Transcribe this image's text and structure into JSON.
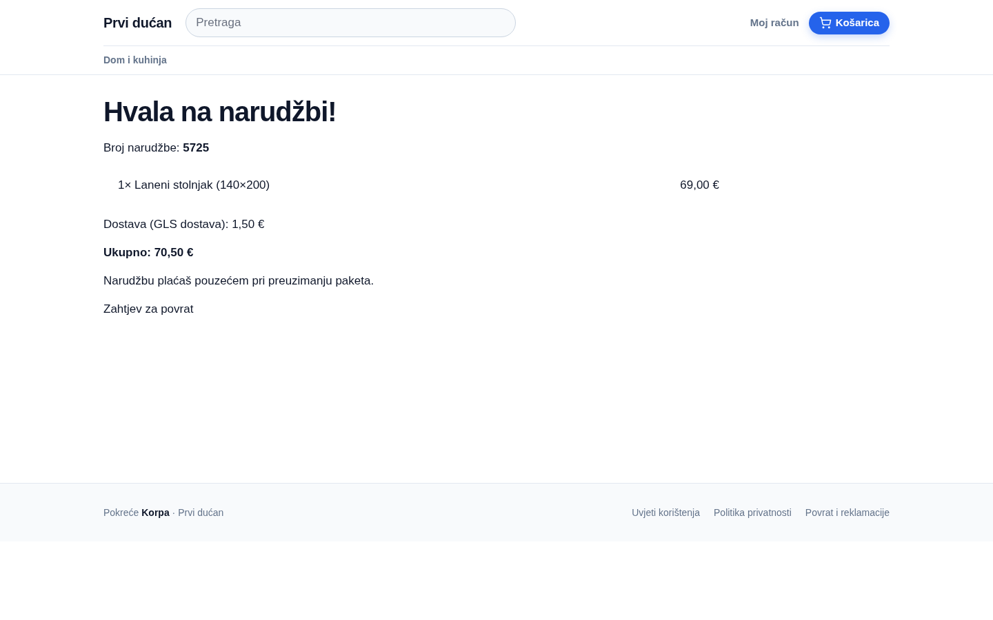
{
  "header": {
    "logo": "Prvi dućan",
    "search": {
      "placeholder": "Pretraga"
    },
    "account_link": "Moj račun",
    "cart_button": "Košarica"
  },
  "categories": [
    {
      "label": "Dom i kuhinja"
    }
  ],
  "confirmation": {
    "title": "Hvala na narudžbi!",
    "order_number": "Broj narudžbe: **5725**",
    "items": [
      {
        "name": "1× Laneni stolnjak (140×200)",
        "price": "69,00 €"
      }
    ],
    "shipping": "Dostava (GLS dostava): 1,50 €",
    "total": "Ukupno: 70,50 €",
    "payment_note": "Narudžbu plaćaš pouzećem pri preuzimanju paketa.",
    "return_link": "Zahtjev za povrat"
  },
  "footer": {
    "credit": "Pokreće **Korpa** · Prvi dućan",
    "links": [
      "Uvjeti korištenja",
      "Politika privatnosti",
      "Povrat i reklamacije"
    ]
  }
}
